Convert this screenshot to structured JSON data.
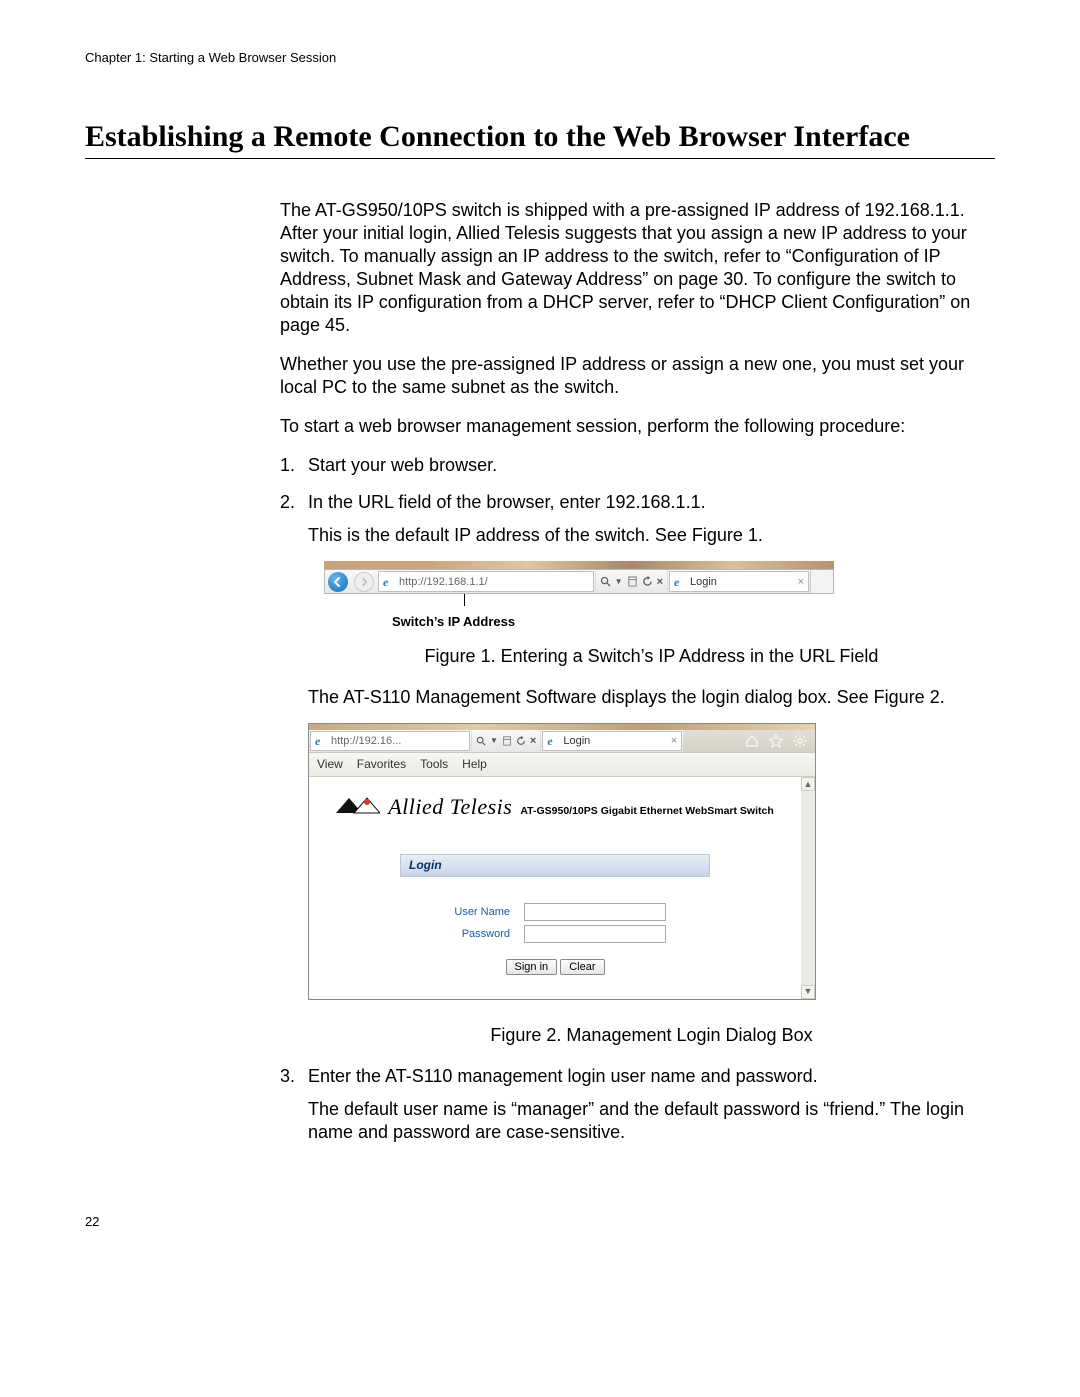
{
  "chapter_line": "Chapter 1: Starting a Web Browser Session",
  "section_title": "Establishing a Remote Connection to the Web Browser Interface",
  "paragraphs": {
    "p1": "The AT-GS950/10PS switch is shipped with a pre-assigned IP address of 192.168.1.1. After your initial login, Allied Telesis suggests that you assign a new IP address to your switch. To manually assign an IP address to the switch, refer to “Configuration of IP Address, Subnet Mask and Gateway Address” on page 30. To configure the switch to obtain its IP configuration from a DHCP server, refer to “DHCP Client Configuration” on page 45.",
    "p2": "Whether you use the pre-assigned IP address or assign a new one, you must set your local PC to the same subnet as the switch.",
    "p3": "To start a web browser management session, perform the following procedure:"
  },
  "steps": {
    "s1": "Start your web browser.",
    "s2": "In the URL field of the browser, enter 192.168.1.1.",
    "s2_sub": "This is the default IP address of the switch. See Figure 1.",
    "s2_after": "The AT-S110 Management Software displays the login dialog box. See Figure 2.",
    "s3": "Enter the AT-S110 management login user name and password.",
    "s3_sub": "The default user name is “manager” and the default password is “friend.” The login name and password are case-sensitive."
  },
  "fig1": {
    "url_text": "http://192.168.1.1/",
    "tab_label": "Login",
    "callout": "Switch’s IP Address",
    "caption": "Figure 1. Entering a Switch’s IP Address in the URL Field"
  },
  "fig2": {
    "url_text": "http://192.16...",
    "tab_label": "Login",
    "menubar": {
      "m0": "View",
      "m1": "Favorites",
      "m2": "Tools",
      "m3": "Help"
    },
    "brand": "Allied Telesis",
    "brand_sub": "AT-GS950/10PS Gigabit Ethernet WebSmart Switch",
    "login_head": "Login",
    "user_label": "User Name",
    "pass_label": "Password",
    "signin": "Sign in",
    "clear": "Clear",
    "caption": "Figure 2. Management Login Dialog Box"
  },
  "page_number": "22"
}
